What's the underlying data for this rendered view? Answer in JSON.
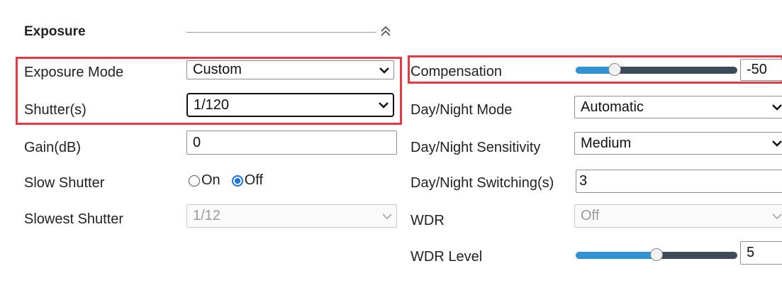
{
  "section": {
    "title": "Exposure"
  },
  "left": {
    "exposure_mode": {
      "label": "Exposure Mode",
      "value": "Custom"
    },
    "shutter": {
      "label": "Shutter(s)",
      "value": "1/120"
    },
    "gain": {
      "label": "Gain(dB)",
      "value": "0"
    },
    "slow_shutter": {
      "label": "Slow Shutter",
      "on": "On",
      "off": "Off",
      "selected": "Off"
    },
    "slowest_shutter": {
      "label": "Slowest Shutter",
      "value": "1/12"
    }
  },
  "right": {
    "compensation": {
      "label": "Compensation",
      "value": "-50",
      "slider_fraction": 0.22
    },
    "day_night_mode": {
      "label": "Day/Night Mode",
      "value": "Automatic"
    },
    "day_night_sensitivity": {
      "label": "Day/Night Sensitivity",
      "value": "Medium"
    },
    "day_night_switching": {
      "label": "Day/Night Switching(s)",
      "value": "3"
    },
    "wdr": {
      "label": "WDR",
      "value": "Off"
    },
    "wdr_level": {
      "label": "WDR Level",
      "value": "5",
      "slider_fraction": 0.5
    }
  },
  "colors": {
    "highlight": "#e53946",
    "slider_fill": "#2f92d3",
    "slider_track": "#3e4b5a",
    "radio_accent": "#1a73e8"
  },
  "icons": {
    "collapse": "double-chevron-up-icon",
    "dropdown": "chevron-down-icon"
  }
}
